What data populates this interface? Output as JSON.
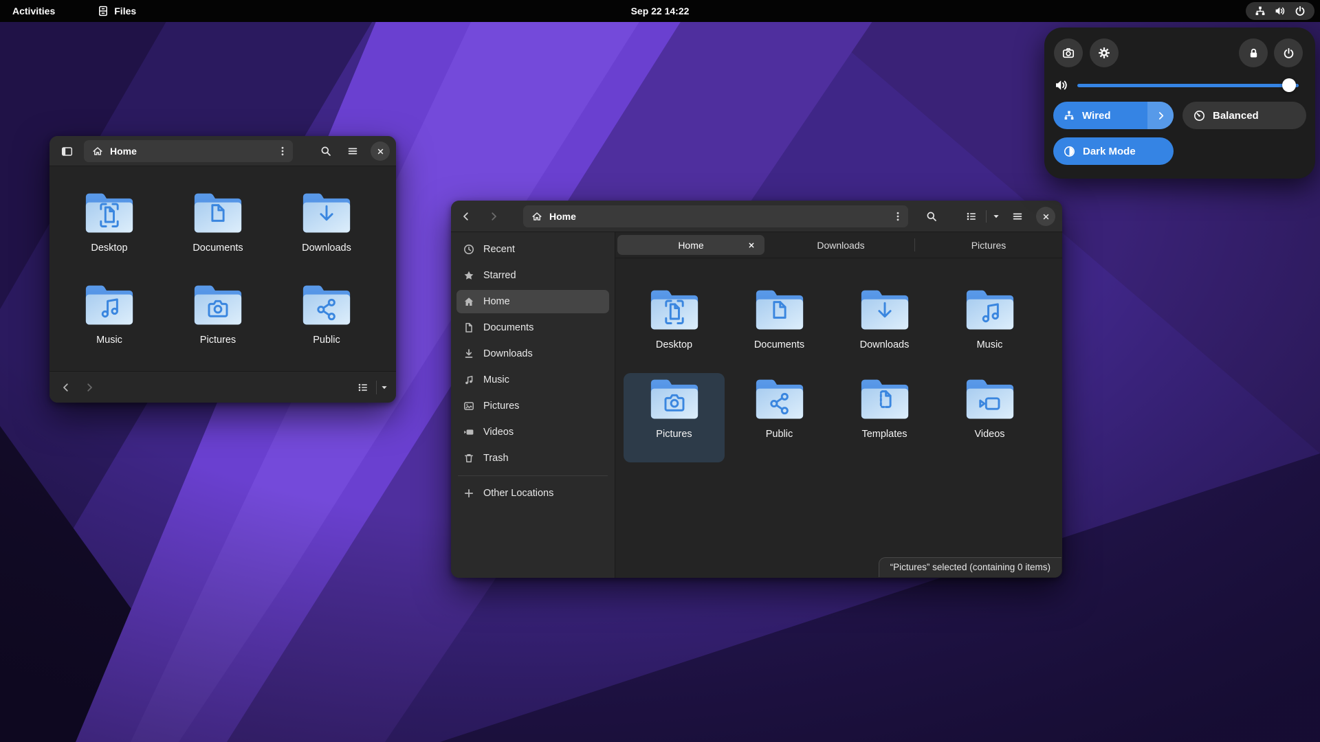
{
  "topbar": {
    "activities_label": "Activities",
    "app_menu_label": "Files",
    "clock": "Sep 22 14:22"
  },
  "quick_settings": {
    "accent_color": "#3584e4",
    "volume_percent": 97,
    "wired_label": "Wired",
    "balanced_label": "Balanced",
    "dark_mode_label": "Dark Mode",
    "top_buttons": [
      "screenshot",
      "settings",
      "lock",
      "power"
    ]
  },
  "small_window": {
    "path_label": "Home",
    "folders": [
      {
        "name": "Desktop",
        "icon": "desktop"
      },
      {
        "name": "Documents",
        "icon": "document"
      },
      {
        "name": "Downloads",
        "icon": "download"
      },
      {
        "name": "Music",
        "icon": "music"
      },
      {
        "name": "Pictures",
        "icon": "pictures"
      },
      {
        "name": "Public",
        "icon": "public"
      }
    ]
  },
  "main_window": {
    "path_label": "Home",
    "tabs": [
      {
        "label": "Home",
        "active": true,
        "closable": true
      },
      {
        "label": "Downloads",
        "active": false
      },
      {
        "label": "Pictures",
        "active": false
      }
    ],
    "sidebar": [
      {
        "label": "Recent",
        "icon": "clock"
      },
      {
        "label": "Starred",
        "icon": "star"
      },
      {
        "label": "Home",
        "icon": "home",
        "active": true
      },
      {
        "label": "Documents",
        "icon": "document"
      },
      {
        "label": "Downloads",
        "icon": "download"
      },
      {
        "label": "Music",
        "icon": "music"
      },
      {
        "label": "Pictures",
        "icon": "image"
      },
      {
        "label": "Videos",
        "icon": "video"
      },
      {
        "label": "Trash",
        "icon": "trash"
      }
    ],
    "other_locations_label": "Other Locations",
    "folders": [
      {
        "name": "Desktop",
        "icon": "desktop"
      },
      {
        "name": "Documents",
        "icon": "document"
      },
      {
        "name": "Downloads",
        "icon": "download"
      },
      {
        "name": "Music",
        "icon": "music"
      },
      {
        "name": "Pictures",
        "icon": "pictures",
        "selected": true
      },
      {
        "name": "Public",
        "icon": "public"
      },
      {
        "name": "Templates",
        "icon": "templates"
      },
      {
        "name": "Videos",
        "icon": "videos"
      }
    ],
    "status_text": "“Pictures” selected (containing 0 items)"
  }
}
